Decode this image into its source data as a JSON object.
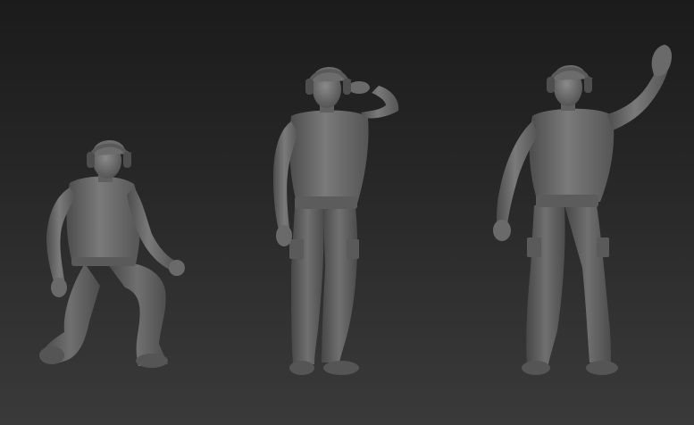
{
  "scene": {
    "background_top": "#1b1b1b",
    "background_bottom": "#3a3a3a",
    "model_color": "#6e6e6e",
    "figures": [
      {
        "pose": "kneeling",
        "accessory": "ear-defenders-icon"
      },
      {
        "pose": "saluting",
        "accessory": "ear-defenders-icon"
      },
      {
        "pose": "waving",
        "accessory": "ear-defenders-icon"
      }
    ]
  }
}
